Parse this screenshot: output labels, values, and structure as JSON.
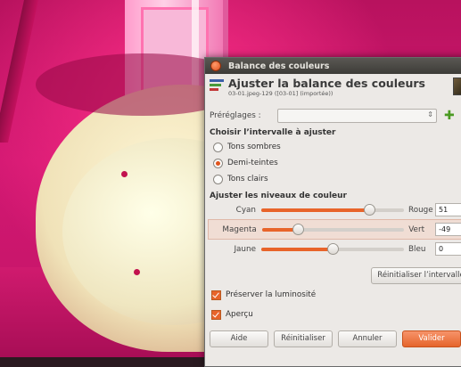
{
  "dialog": {
    "window_title": "Balance des couleurs",
    "heading": "Ajuster la balance des couleurs",
    "subheading": "03-01.jpeg-129 ([03-01] (importée))",
    "presets_label": "Préréglages :",
    "presets_value": "",
    "range_section": "Choisir l’intervalle à ajuster",
    "ranges": [
      {
        "label": "Tons sombres",
        "selected": false
      },
      {
        "label": "Demi-teintes",
        "selected": true
      },
      {
        "label": "Tons clairs",
        "selected": false
      }
    ],
    "levels_section": "Ajuster les niveaux de couleur",
    "sliders": [
      {
        "left": "Cyan",
        "right": "Rouge",
        "value": "51",
        "fraction": 0.755
      },
      {
        "left": "Magenta",
        "right": "Vert",
        "value": "-49",
        "fraction": 0.255
      },
      {
        "left": "Jaune",
        "right": "Bleu",
        "value": "0",
        "fraction": 0.5
      }
    ],
    "reset_range_label": "Réinitialiser l’intervalle",
    "preserve_luminosity_label": "Préserver la luminosité",
    "preview_label": "Aperçu",
    "buttons": {
      "help": "Aide",
      "reset": "Réinitialiser",
      "cancel": "Annuler",
      "ok": "Valider"
    }
  },
  "colors": {
    "accent": "#e8642a",
    "photo_tint": "#d21872"
  }
}
